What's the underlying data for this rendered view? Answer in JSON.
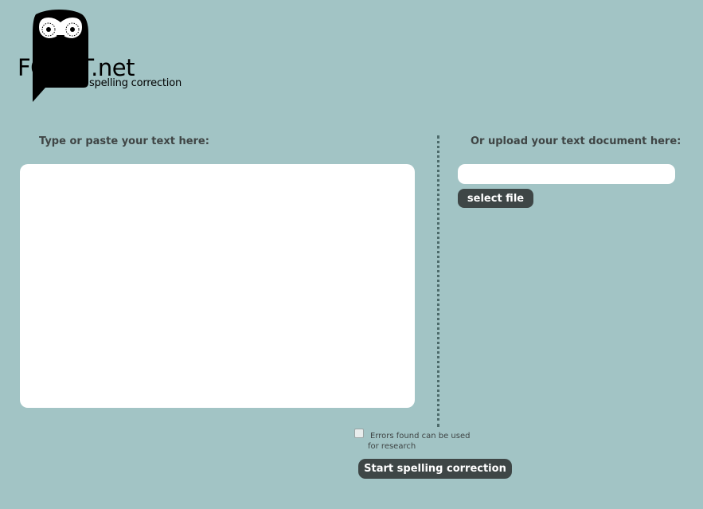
{
  "logo": {
    "brand_prefix": "FOWL",
    "brand_suffix": "T.net",
    "tagline": "spelling correction",
    "icon": "owl-icon"
  },
  "text_panel": {
    "heading": "Type or paste your text here:",
    "value": "",
    "placeholder": ""
  },
  "upload_panel": {
    "heading": "Or upload your text document here:",
    "file_value": "",
    "select_label": "select file"
  },
  "research": {
    "checked": false,
    "label_line1": "Errors found can be used",
    "label_line2": "for research"
  },
  "actions": {
    "start_label": "Start spelling correction"
  },
  "colors": {
    "background": "#a2c4c5",
    "button": "#3e4646",
    "text": "#3f4545"
  }
}
